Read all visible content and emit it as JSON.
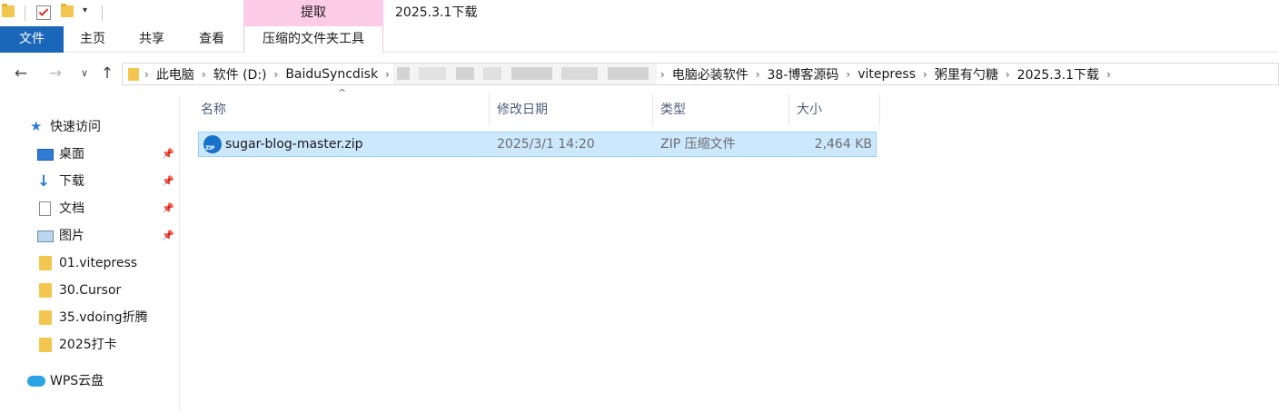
{
  "window": {
    "title": "2025.3.1下载"
  },
  "ribbon": {
    "contextual_label": "提取",
    "tabs": {
      "file": "文件",
      "home": "主页",
      "share": "共享",
      "view": "查看",
      "tools": "压缩的文件夹工具"
    }
  },
  "address": {
    "crumbs_start": [
      "此电脑",
      "软件 (D:)",
      "BaiduSyncdisk"
    ],
    "crumbs_end": [
      "电脑必装软件",
      "38-博客源码",
      "vitepress",
      "粥里有勺糖",
      "2025.3.1下载"
    ]
  },
  "sidebar": {
    "quick_access": "快速访问",
    "items": [
      {
        "label": "桌面",
        "icon": "desktop-icon",
        "pinned": true
      },
      {
        "label": "下载",
        "icon": "download-icon",
        "pinned": true
      },
      {
        "label": "文档",
        "icon": "document-icon",
        "pinned": true
      },
      {
        "label": "图片",
        "icon": "picture-icon",
        "pinned": true
      },
      {
        "label": "01.vitepress",
        "icon": "folder-icon",
        "pinned": false
      },
      {
        "label": "30.Cursor",
        "icon": "folder-icon",
        "pinned": false
      },
      {
        "label": "35.vdoing折腾",
        "icon": "folder-icon",
        "pinned": false
      },
      {
        "label": "2025打卡",
        "icon": "folder-icon",
        "pinned": false
      }
    ],
    "wps": "WPS云盘"
  },
  "columns": {
    "name": "名称",
    "date": "修改日期",
    "type": "类型",
    "size": "大小"
  },
  "files": [
    {
      "name": "sugar-blog-master.zip",
      "date": "2025/3/1 14:20",
      "type": "ZIP 压缩文件",
      "size": "2,464 KB",
      "icon": "zip-archive-icon"
    }
  ],
  "colors": {
    "accent": "#1a66b8",
    "contextual": "#fbcbe7",
    "selection": "#cce8ff",
    "selection_border": "#99d1ff"
  }
}
